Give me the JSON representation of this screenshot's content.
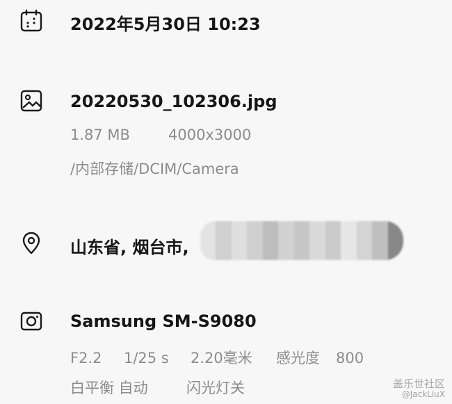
{
  "date": {
    "icon": "calendar-icon",
    "datetime": "2022年5月30日  10:23"
  },
  "file": {
    "icon": "image-icon",
    "name": "20220530_102306.jpg",
    "size": "1.87 MB",
    "resolution": "4000x3000",
    "path": "/内部存储/DCIM/Camera"
  },
  "location": {
    "icon": "location-pin-icon",
    "text": "山东省, 烟台市,"
  },
  "camera": {
    "icon": "camera-icon",
    "model": "Samsung  SM-S9080",
    "aperture": "F2.2",
    "shutter": "1/25 s",
    "focal_length": "2.20毫米",
    "iso_label": "感光度",
    "iso_value": "800",
    "white_balance": "白平衡  自动",
    "flash": "闪光灯关"
  },
  "watermark": {
    "site": "盖乐世社区",
    "user": "@JackLiuX"
  }
}
